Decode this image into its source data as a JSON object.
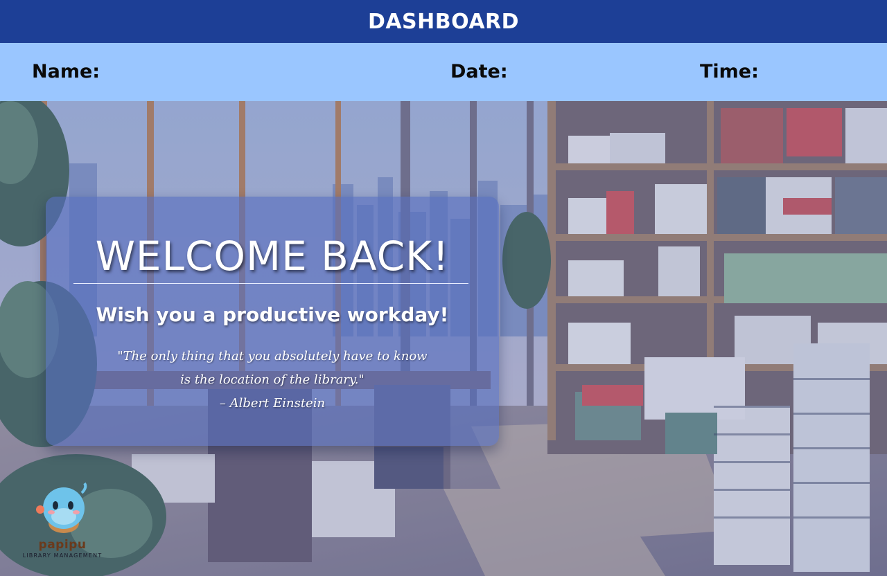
{
  "header": {
    "title": "DASHBOARD",
    "accent": "#1d3f96"
  },
  "info_bar": {
    "name_label": "Name:",
    "date_label": "Date:",
    "time_label": "Time:",
    "background": "#9ac6ff"
  },
  "welcome": {
    "title": "WELCOME BACK!",
    "subtitle": "Wish you a productive workday!",
    "quote_line1": "\"The only thing that you absolutely have to know",
    "quote_line2": "is the location of the library.\"",
    "quote_author": "– Albert Einstein"
  },
  "logo": {
    "word": "papipu",
    "tagline": "LIBRARY MANAGEMENT",
    "icon": "mascot-icon"
  },
  "background": {
    "icon": "library-office-illustration"
  }
}
